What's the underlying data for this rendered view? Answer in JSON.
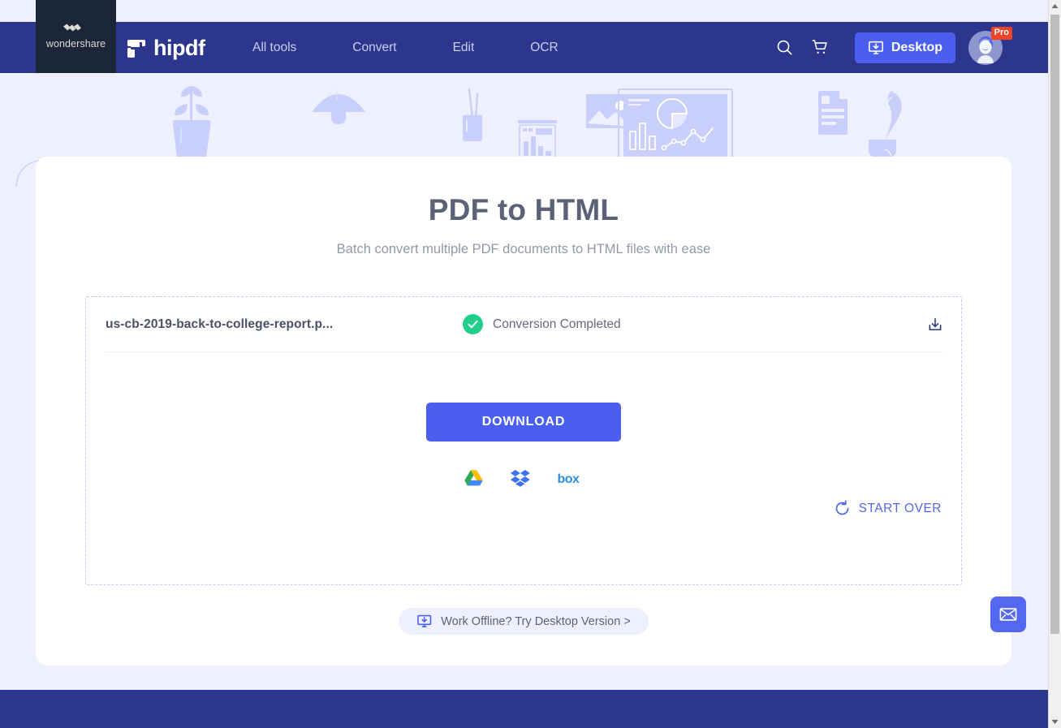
{
  "header": {
    "brand_box": {
      "name": "wondershare",
      "icon": "wondershare-mark"
    },
    "product": {
      "name": "hipdf",
      "icon": "hipdf-mark"
    },
    "nav": [
      {
        "label": "All tools",
        "name": "all-tools"
      },
      {
        "label": "Convert",
        "name": "convert"
      },
      {
        "label": "Edit",
        "name": "edit"
      },
      {
        "label": "OCR",
        "name": "ocr"
      }
    ],
    "search_icon": "search-icon",
    "cart_icon": "cart-icon",
    "desktop_button": {
      "label": "Desktop",
      "icon": "desktop-download-icon"
    },
    "account": {
      "badge": "Pro",
      "icon": "user-avatar"
    },
    "colors": {
      "bar": "#2b368c",
      "logo_box": "#1b2639",
      "accent": "#4a5ef0",
      "pro_badge": "#ef4326"
    }
  },
  "main": {
    "title": "PDF to HTML",
    "subtitle": "Batch convert multiple PDF documents to HTML files with ease",
    "file": {
      "name": "us-cb-2019-back-to-college-report.p...",
      "status": "Conversion Completed",
      "status_icon": "check-circle-icon",
      "row_download_icon": "download-icon"
    },
    "download_button": "DOWNLOAD",
    "cloud_targets": [
      {
        "label": "Google Drive",
        "name": "google-drive-icon"
      },
      {
        "label": "Dropbox",
        "name": "dropbox-icon"
      },
      {
        "label": "Box",
        "name": "box-icon"
      }
    ],
    "start_over": {
      "label": "START OVER",
      "icon": "refresh-icon"
    },
    "offline_pill": {
      "label": "Work Offline? Try Desktop Version >",
      "icon": "desktop-download-icon"
    },
    "colors": {
      "primary": "#4a5ef0",
      "success": "#22ce8b",
      "title": "#5c6275",
      "subtitle": "#9398a8"
    }
  },
  "widgets": {
    "mail_fab": {
      "name": "mail-icon",
      "label": "Contact"
    }
  },
  "scrollbar": {
    "up": "▲",
    "down": "▼"
  }
}
